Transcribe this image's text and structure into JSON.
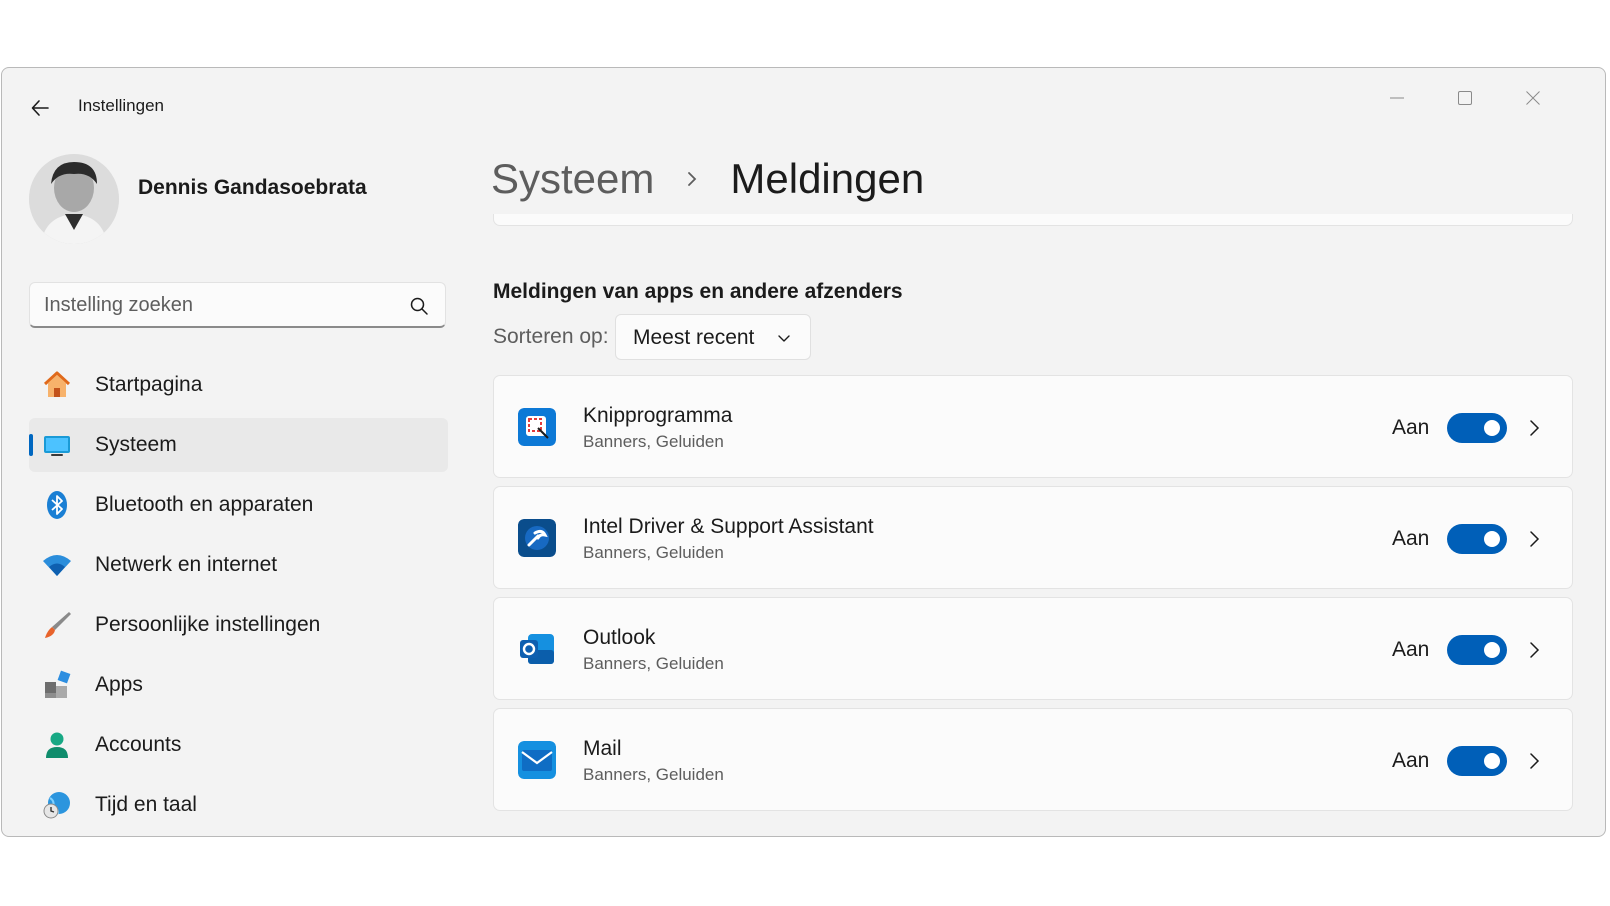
{
  "window": {
    "title": "Instellingen"
  },
  "user": {
    "name": "Dennis Gandasoebrata"
  },
  "search": {
    "placeholder": "Instelling zoeken"
  },
  "sidebar": {
    "items": [
      {
        "label": "Startpagina",
        "icon": "home-icon"
      },
      {
        "label": "Systeem",
        "icon": "system-display-icon",
        "active": true
      },
      {
        "label": "Bluetooth en apparaten",
        "icon": "bluetooth-icon"
      },
      {
        "label": "Netwerk en internet",
        "icon": "wifi-icon"
      },
      {
        "label": "Persoonlijke instellingen",
        "icon": "paintbrush-icon"
      },
      {
        "label": "Apps",
        "icon": "apps-icon"
      },
      {
        "label": "Accounts",
        "icon": "account-icon"
      },
      {
        "label": "Tijd en taal",
        "icon": "globe-clock-icon"
      }
    ]
  },
  "breadcrumb": {
    "parent": "Systeem",
    "current": "Meldingen"
  },
  "section": {
    "title": "Meldingen van apps en andere afzenders"
  },
  "sort": {
    "label": "Sorteren op:",
    "value": "Meest recent"
  },
  "apps": [
    {
      "name": "Knipprogramma",
      "subtitle": "Banners, Geluiden",
      "state": "Aan",
      "on": true,
      "icon": "snipping-tool-icon"
    },
    {
      "name": "Intel Driver & Support Assistant",
      "subtitle": "Banners, Geluiden",
      "state": "Aan",
      "on": true,
      "icon": "intel-dsa-icon"
    },
    {
      "name": "Outlook",
      "subtitle": "Banners, Geluiden",
      "state": "Aan",
      "on": true,
      "icon": "outlook-icon"
    },
    {
      "name": "Mail",
      "subtitle": "Banners, Geluiden",
      "state": "Aan",
      "on": true,
      "icon": "mail-icon"
    }
  ],
  "colors": {
    "accent": "#005fb8",
    "window_bg": "#f3f3f3",
    "card_bg": "#fbfbfb"
  }
}
